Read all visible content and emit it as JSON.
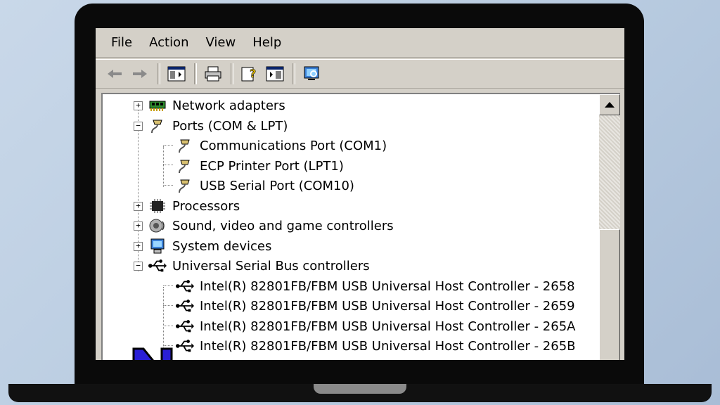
{
  "menu": [
    "File",
    "Action",
    "View",
    "Help"
  ],
  "toolbar": {
    "icons": [
      "back-arrow-icon",
      "forward-arrow-icon",
      "show-hide-tree-icon",
      "print-icon",
      "help-icon",
      "properties-icon",
      "scan-hardware-icon"
    ]
  },
  "tree": {
    "nodes": [
      {
        "label": "Network adapters",
        "expanded": false,
        "icon": "network-adapter-icon"
      },
      {
        "label": "Ports (COM & LPT)",
        "expanded": true,
        "icon": "port-icon"
      },
      {
        "label": "Communications Port (COM1)",
        "icon": "port-icon"
      },
      {
        "label": "ECP Printer Port (LPT1)",
        "icon": "port-icon"
      },
      {
        "label": "USB Serial Port (COM10)",
        "icon": "port-icon"
      },
      {
        "label": "Processors",
        "expanded": false,
        "icon": "processor-icon"
      },
      {
        "label": "Sound, video and game controllers",
        "expanded": false,
        "icon": "speaker-icon"
      },
      {
        "label": "System devices",
        "expanded": false,
        "icon": "system-device-icon"
      },
      {
        "label": "Universal Serial Bus controllers",
        "expanded": true,
        "icon": "usb-icon"
      },
      {
        "label": "Intel(R) 82801FB/FBM USB Universal Host Controller - 2658",
        "icon": "usb-icon"
      },
      {
        "label": "Intel(R) 82801FB/FBM USB Universal Host Controller - 2659",
        "icon": "usb-icon"
      },
      {
        "label": "Intel(R) 82801FB/FBM USB Universal Host Controller - 265A",
        "icon": "usb-icon"
      },
      {
        "label": "Intel(R) 82801FB/FBM USB Universal Host Controller - 265B",
        "icon": "usb-icon"
      }
    ]
  },
  "colors": {
    "window_bg": "#d4d0c8",
    "logo_fill": "#2a1fd6",
    "logo_outline": "#000000"
  }
}
